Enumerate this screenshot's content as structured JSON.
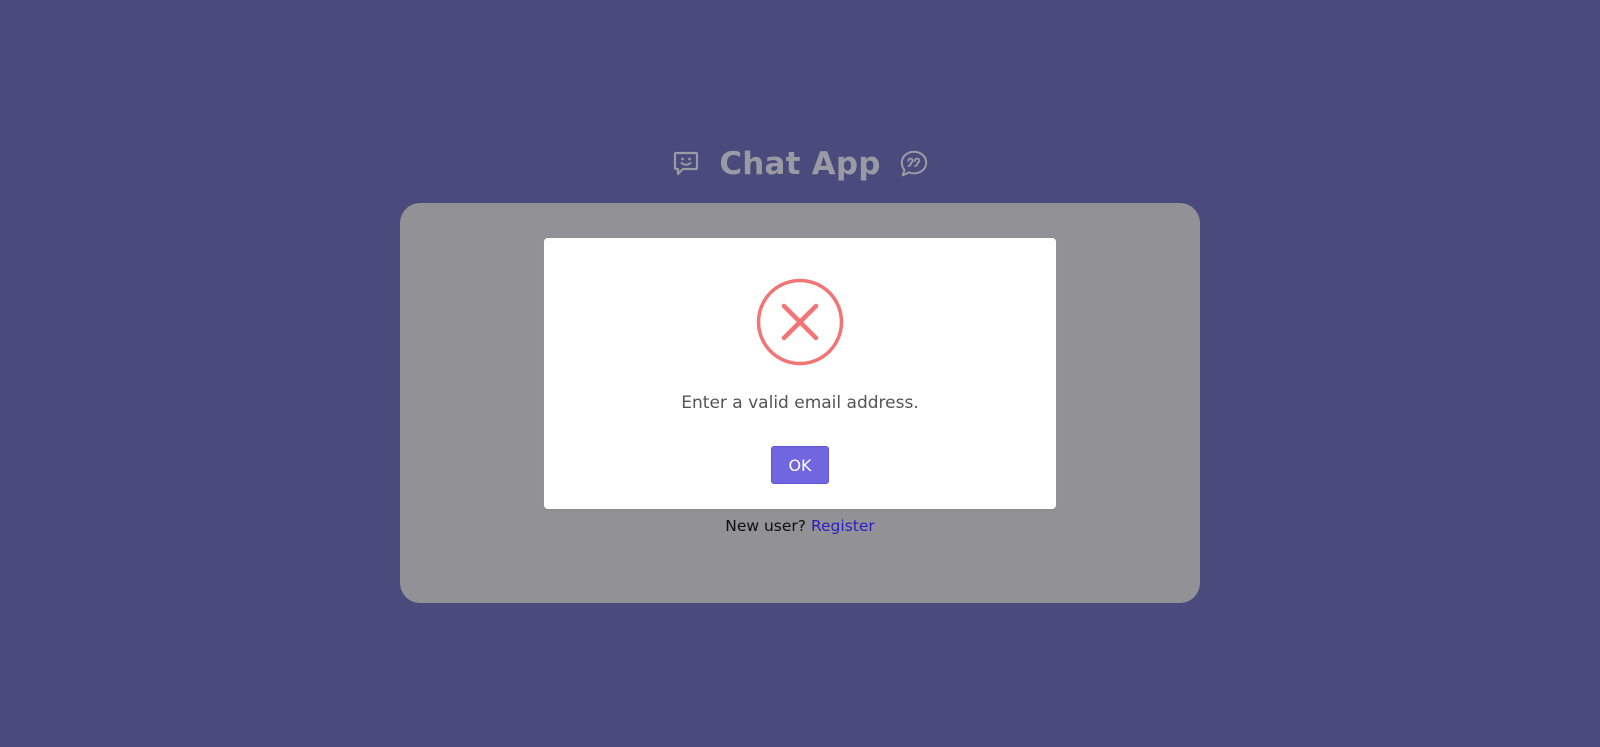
{
  "app": {
    "title": "Chat App",
    "left_icon": "smile-chat-icon",
    "right_icon": "quote-bubble-icon"
  },
  "login_card": {
    "new_user_text": "New user?",
    "register_link": "Register"
  },
  "alert": {
    "icon": "error-x-icon",
    "message": "Enter a valid email address.",
    "ok_label": "OK",
    "icon_color": "#f27474",
    "button_color": "#7166e0"
  },
  "colors": {
    "background": "#4a4a7c",
    "card_overlay": "#929296",
    "header_text": "#9a9aa4",
    "link": "#2a1fc0"
  }
}
